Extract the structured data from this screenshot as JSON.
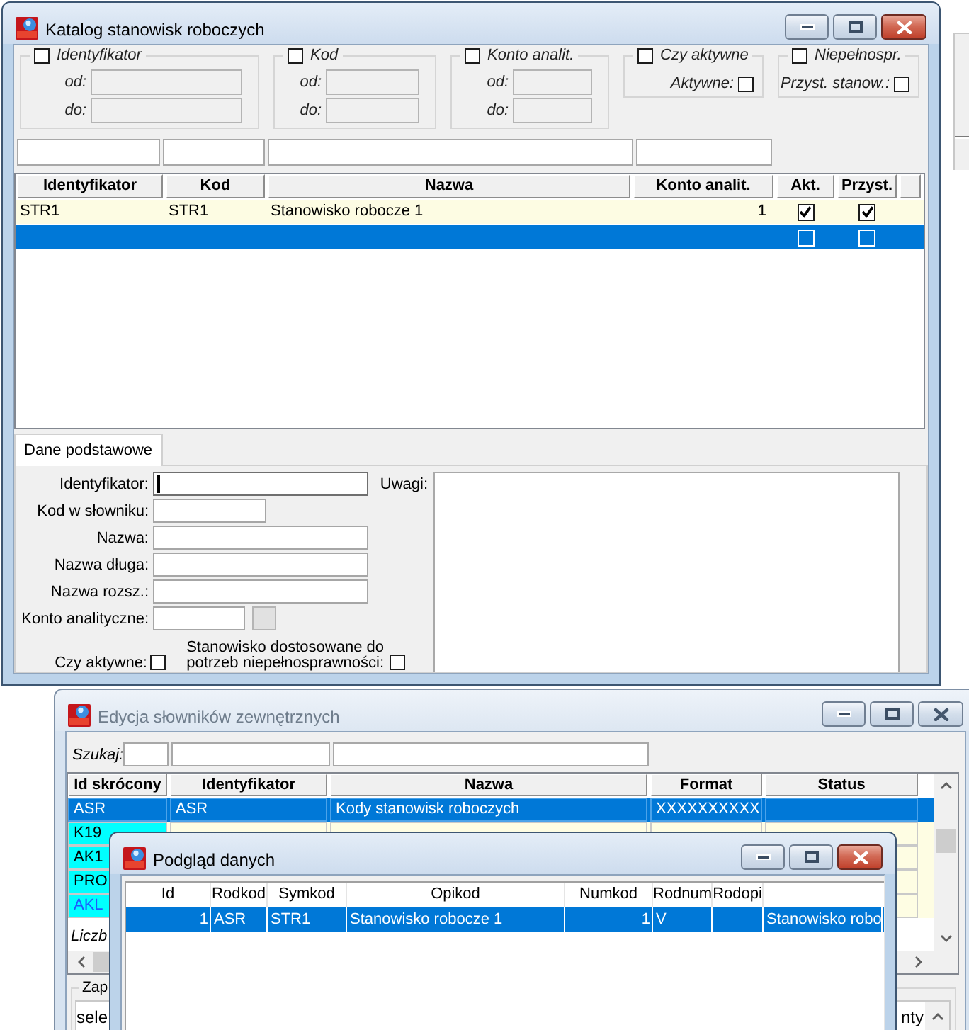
{
  "catalog_window": {
    "title": "Katalog stanowisk roboczych",
    "active": true,
    "filters": [
      {
        "kind": "range",
        "label": "Identyfikator",
        "checked": false,
        "from_label": "od:",
        "to_label": "do:"
      },
      {
        "kind": "range",
        "label": "Kod",
        "checked": false,
        "from_label": "od:",
        "to_label": "do:"
      },
      {
        "kind": "range",
        "label": "Konto analit.",
        "checked": false,
        "from_label": "od:",
        "to_label": "do:"
      },
      {
        "kind": "flag",
        "label": "Czy aktywne",
        "checked": false,
        "option_label": "Aktywne:",
        "option_checked": false
      },
      {
        "kind": "flag",
        "label": "Niepełnospr.",
        "checked": false,
        "option_label": "Przyst. stanow.:",
        "option_checked": false
      }
    ],
    "table": {
      "columns": [
        "Identyfikator",
        "Kod",
        "Nazwa",
        "Konto analit.",
        "Akt.",
        "Przyst."
      ],
      "rows": [
        {
          "identifier": "STR1",
          "code": "STR1",
          "name": "Stanowisko robocze 1",
          "account": "1",
          "active": true,
          "adapted": true,
          "selected": false
        },
        {
          "active": false,
          "adapted": false,
          "selected": true
        }
      ]
    },
    "tabs": [
      {
        "label": "Dane podstawowe",
        "selected": true
      }
    ],
    "form": {
      "fields": [
        {
          "kind": "wide",
          "label": "Identyfikator:",
          "focused": true
        },
        {
          "kind": "short",
          "label": "Kod w słowniku:",
          "focused": false
        },
        {
          "kind": "wide",
          "label": "Nazwa:",
          "focused": false
        },
        {
          "kind": "wide",
          "label": "Nazwa długa:",
          "focused": false
        },
        {
          "kind": "wide",
          "label": "Nazwa rozsz.:",
          "focused": false
        },
        {
          "kind": "lookup",
          "label": "Konto analityczne:",
          "focused": false
        }
      ],
      "checkboxes": [
        {
          "label": "Czy aktywne:",
          "checked": false
        },
        {
          "label": "Stanowisko dostosowane do potrzeb niepełnosprawności:",
          "checked": false
        }
      ],
      "notes_label": "Uwagi:"
    }
  },
  "dictionary_window": {
    "title": "Edycja słowników zewnętrznych",
    "active": false,
    "search_label": "Szukaj:",
    "table": {
      "columns": [
        "Id skrócony",
        "Identyfikator",
        "Nazwa",
        "Format",
        "Status"
      ],
      "rows": [
        {
          "short_id": "ASR",
          "identifier": "ASR",
          "name": "Kody stanowisk roboczych",
          "format": "XXXXXXXXXX",
          "selected": true,
          "highlighted": false
        },
        {
          "short_id": "K19",
          "selected": false,
          "highlighted": false,
          "color": "#00ffff"
        },
        {
          "short_id": "AK1",
          "selected": false,
          "highlighted": false,
          "color": "#00ffff"
        },
        {
          "short_id": "PRO",
          "selected": false,
          "highlighted": false,
          "color": "#00ffff"
        },
        {
          "short_id": "AKL",
          "selected": false,
          "highlighted": true,
          "color": "#00ffff"
        }
      ]
    },
    "footer_text": "Liczb",
    "group_label": "Zap",
    "text_start": "sele",
    "text_end": "nty"
  },
  "preview_window": {
    "title": "Podgląd danych",
    "active": true,
    "table": {
      "columns": [
        "Id",
        "Rodkod",
        "Symkod",
        "Opikod",
        "Numkod",
        "Rodnum",
        "Rodopi"
      ],
      "rows": [
        {
          "id": "1",
          "rodkod": "ASR",
          "symkod": "STR1",
          "opikod": "Stanowisko robocze 1",
          "numkod": "1",
          "rodnum": "V",
          "column_8": "Stanowisko robo",
          "selected": true
        }
      ]
    }
  }
}
